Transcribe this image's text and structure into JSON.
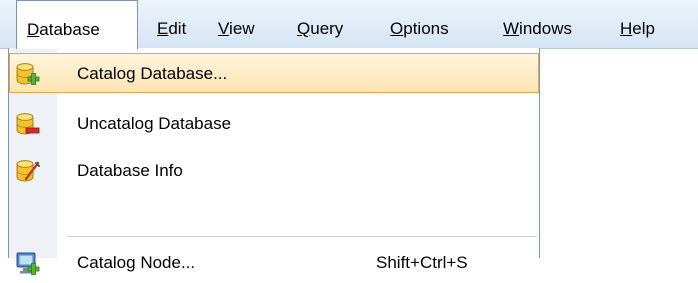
{
  "menubar": {
    "items": [
      {
        "label": "Database"
      },
      {
        "label": "Edit"
      },
      {
        "label": "View"
      },
      {
        "label": "Query"
      },
      {
        "label": "Options"
      },
      {
        "label": "Windows"
      },
      {
        "label": "Help"
      }
    ]
  },
  "dropdown": {
    "items": [
      {
        "label": "Catalog Database...",
        "icon": "catalog-database-icon",
        "highlighted": true
      },
      {
        "label": "Uncatalog Database",
        "icon": "uncatalog-database-icon"
      },
      {
        "label": "Database Info",
        "icon": "database-info-icon"
      },
      {
        "label": "Catalog Node...",
        "icon": "catalog-node-icon",
        "shortcut": "Shift+Ctrl+S"
      }
    ]
  },
  "colors": {
    "menubar_bg": "#dce8f5",
    "hover_bg": "#fde9c0",
    "hover_border": "#e9a648",
    "database_gold": "#f2c22c",
    "add_green": "#5bb334",
    "remove_red": "#d92b2b"
  }
}
